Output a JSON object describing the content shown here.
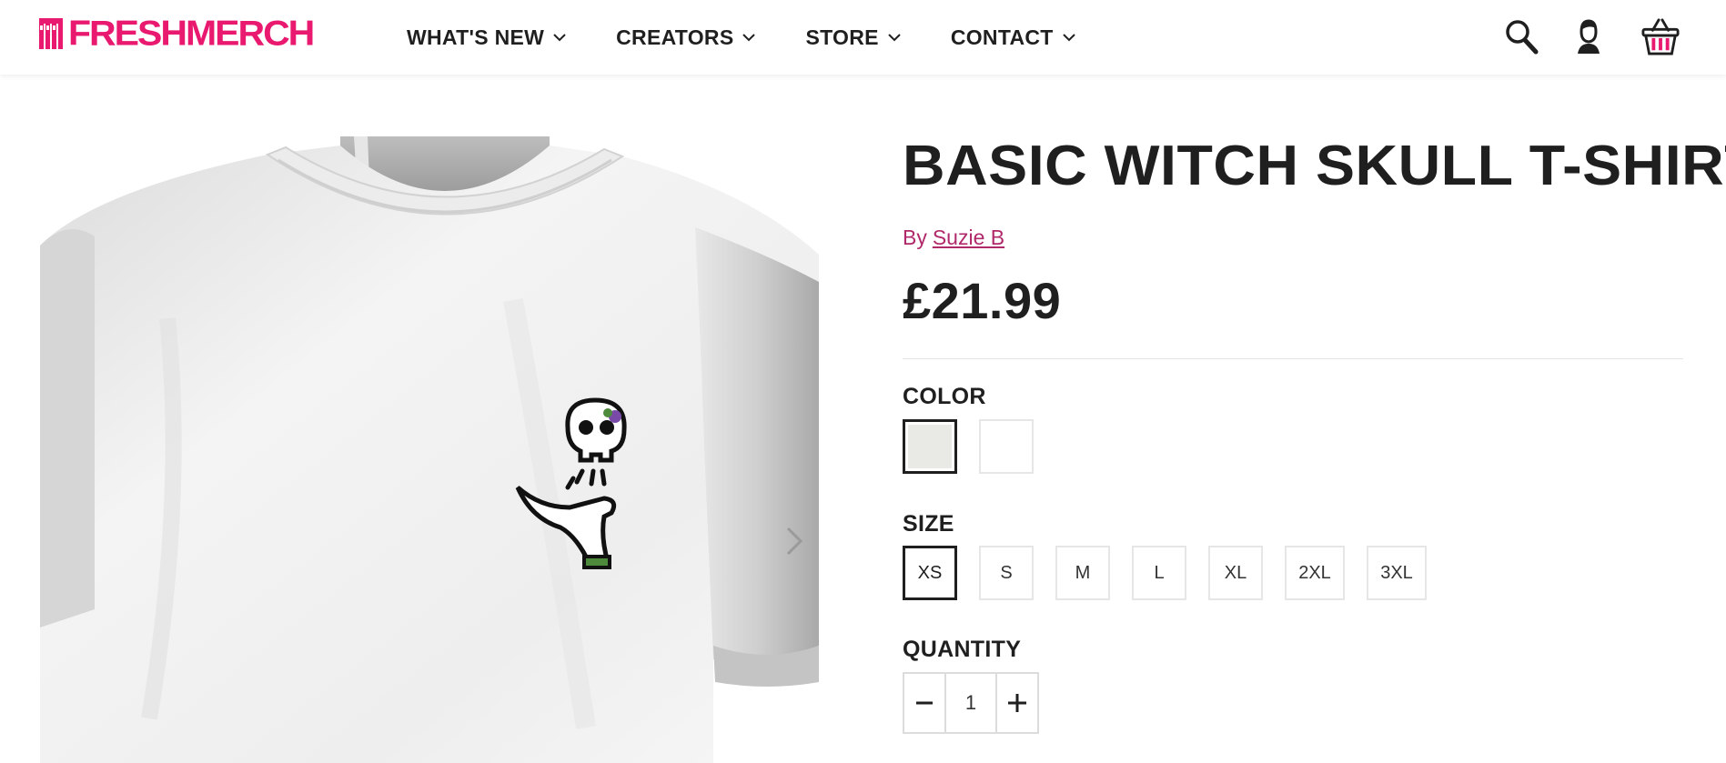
{
  "brand": {
    "name": "FRESHMERCH",
    "accent_color": "#e8196f"
  },
  "nav": {
    "items": [
      {
        "label": "WHAT'S NEW"
      },
      {
        "label": "CREATORS"
      },
      {
        "label": "STORE"
      },
      {
        "label": "CONTACT"
      }
    ]
  },
  "header_icons": [
    "search-icon",
    "account-icon",
    "basket-icon"
  ],
  "gallery": {
    "image_subject": "white t-shirt with skull-in-hand print",
    "arrow_icon": "chevron-right-icon"
  },
  "product": {
    "title": "BASIC WITCH SKULL T-SHIRT",
    "by_prefix": "By",
    "creator": "Suzie B",
    "creator_color": "#b0296a",
    "price": "£21.99"
  },
  "options": {
    "color_label": "COLOR",
    "colors": [
      {
        "name": "ash",
        "hex": "#e9e9e6",
        "selected": true
      },
      {
        "name": "white",
        "hex": "#ffffff",
        "selected": false
      }
    ],
    "size_label": "SIZE",
    "sizes": [
      {
        "label": "XS",
        "selected": true
      },
      {
        "label": "S",
        "selected": false
      },
      {
        "label": "M",
        "selected": false
      },
      {
        "label": "L",
        "selected": false
      },
      {
        "label": "XL",
        "selected": false
      },
      {
        "label": "2XL",
        "selected": false
      },
      {
        "label": "3XL",
        "selected": false
      }
    ],
    "quantity_label": "QUANTITY",
    "quantity": "1"
  }
}
